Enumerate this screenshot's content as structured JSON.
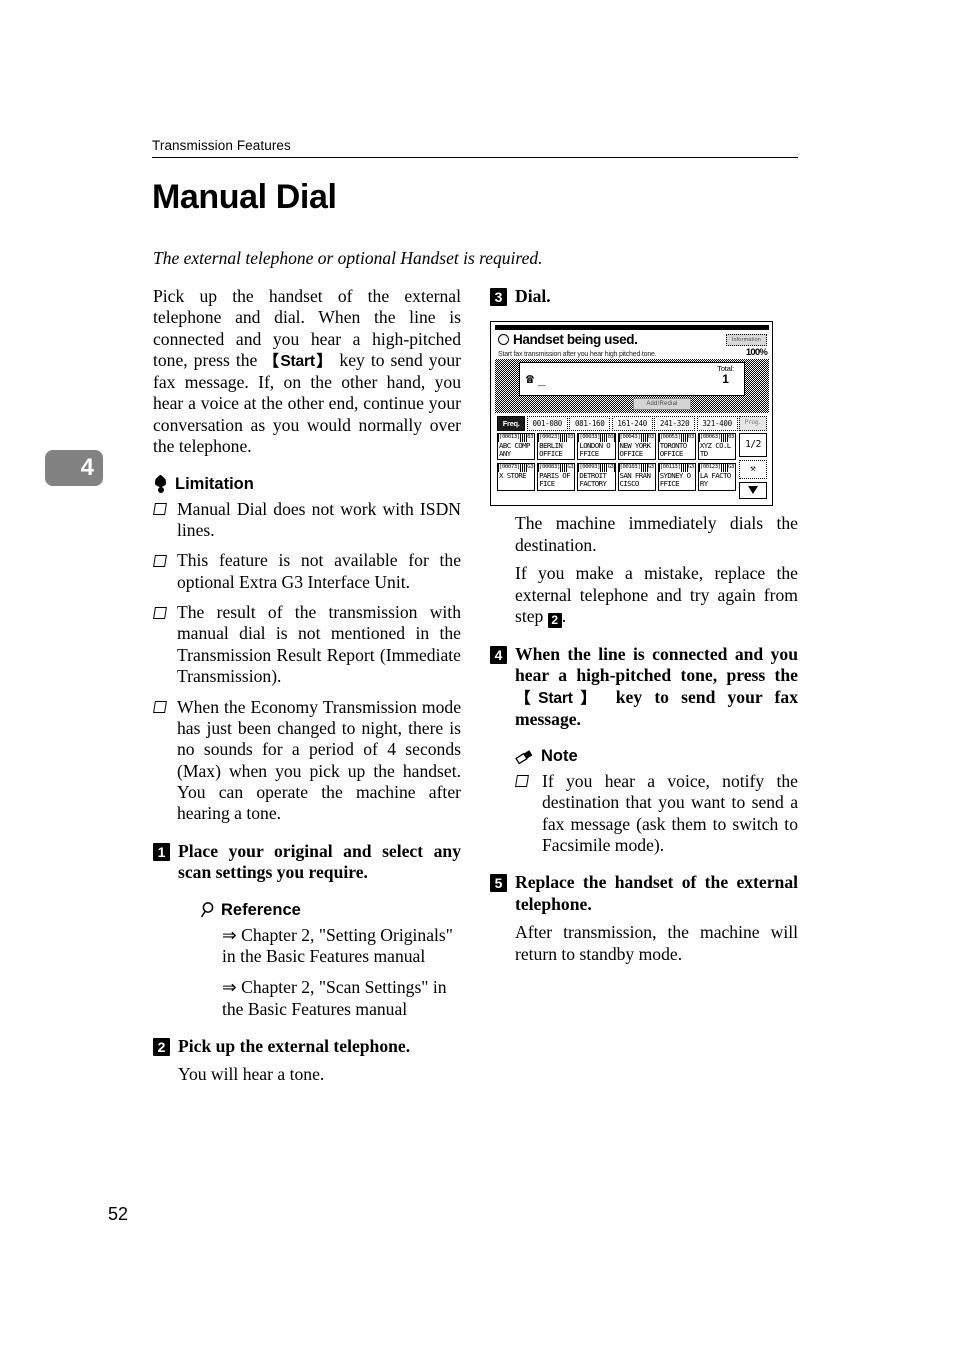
{
  "header": {
    "running_head": "Transmission Features"
  },
  "title": "Manual Dial",
  "intro_italic": "The external telephone or optional Handset is required.",
  "chapter_tab": "4",
  "page_number": "52",
  "left_column": {
    "intro_paragraph_part1": "Pick up the handset of the external telephone and dial. When the line is connected and you hear a high-pitched tone, press the ",
    "start_key": "【Start】",
    "intro_paragraph_part2": " key to send your fax message. If, on the other hand, you hear a voice at the other end, continue your conversation as you would normally over the telephone.",
    "limitation_heading": "Limitation",
    "limitation_icon": "balloon-icon",
    "limitations": [
      "Manual Dial does not work with ISDN lines.",
      "This feature is not available for the optional Extra G3 Interface Unit.",
      "The result of the transmission with manual dial is not mentioned in the Transmission Result Report (Immediate Transmission).",
      "When the Economy Transmission mode has just been changed to night, there is no sounds for a period of 4 seconds (Max) when you pick up the handset. You can operate the machine after hearing a tone."
    ],
    "step1": {
      "number": "1",
      "title": "Place your original and select any scan settings you require.",
      "reference_heading": "Reference",
      "reference_icon": "magnifier-icon",
      "references": [
        "⇒ Chapter 2, \"Setting Originals\" in the Basic Features manual",
        "⇒ Chapter 2, \"Scan Settings\" in the Basic Features manual"
      ]
    },
    "step2": {
      "number": "2",
      "title": "Pick up the external telephone.",
      "body": "You will hear a tone."
    }
  },
  "right_column": {
    "step3": {
      "number": "3",
      "title": "Dial.",
      "body1": "The machine immediately dials the destination.",
      "body2_part1": "If you make a mistake, replace the external telephone and try again from step ",
      "body2_step_ref": "2",
      "body2_part2": "."
    },
    "step4": {
      "number": "4",
      "title_part1": "When the line is connected and you hear a high-pitched tone, press the ",
      "start_key": "【Start】",
      "title_part2": " key to send your fax message.",
      "note_heading": "Note",
      "note_icon": "pencil-icon",
      "notes": [
        "If you hear a voice, notify the destination that you want to send a fax message (ask them to switch to Facsimile mode)."
      ]
    },
    "step5": {
      "number": "5",
      "title": "Replace the handset of the external telephone.",
      "body": "After transmission, the machine will return to standby mode."
    }
  },
  "lcd_screen": {
    "status_icon": "ring-icon",
    "status_title": "Handset being used.",
    "info_button": "Information",
    "subtitle": "Start fax transmission after you hear high pitched tone.",
    "percent": "100%",
    "phone_icon": "telephone-icon",
    "entry_value": "_",
    "total_label": "Total:",
    "total_value": "1",
    "add_redial_button": "Add/Redial",
    "tabs": [
      {
        "label": "Freq.",
        "selected": true
      },
      {
        "label": "001-080",
        "selected": false
      },
      {
        "label": "081-160",
        "selected": false
      },
      {
        "label": "161-240",
        "selected": false
      },
      {
        "label": "241-320",
        "selected": false
      },
      {
        "label": "321-400",
        "selected": false
      }
    ],
    "tab_overflow": "Prog.",
    "speed_dials_row1": [
      {
        "code": "[00013]",
        "type": "03",
        "line1": "ABC COMP",
        "line2": "ANY"
      },
      {
        "code": "[00023]",
        "type": "03",
        "line1": "BERLIN",
        "line2": "OFFICE"
      },
      {
        "code": "[00033]",
        "type": "03",
        "line1": "LONDON O",
        "line2": "FFICE"
      },
      {
        "code": "[00043]",
        "type": "03",
        "line1": "NEW YORK",
        "line2": "OFFICE"
      },
      {
        "code": "[00053]",
        "type": "03",
        "line1": "TORONTO",
        "line2": "OFFICE"
      },
      {
        "code": "[00063]",
        "type": "03",
        "line1": "XYZ CO.L",
        "line2": "TD"
      }
    ],
    "speed_dials_row2": [
      {
        "code": "[00073]",
        "type": "G3",
        "line1": "X STORE",
        "line2": ""
      },
      {
        "code": "[00083]",
        "type": "G3",
        "line1": "PARIS OF",
        "line2": "FICE"
      },
      {
        "code": "[00093]",
        "type": "G3",
        "line1": "DETROIT",
        "line2": "FACTORY"
      },
      {
        "code": "[00103]",
        "type": "G3",
        "line1": "SAN FRAN",
        "line2": "CISCO"
      },
      {
        "code": "[00113]",
        "type": "G3",
        "line1": "SYDNEY O",
        "line2": "FFICE"
      },
      {
        "code": "[00123]",
        "type": "G3",
        "line1": "LA FACTO",
        "line2": "RY"
      }
    ],
    "page_indicator": "1/2",
    "switch_button_icon": "switch-icon",
    "scroll_down_icon": "triangle-down-icon"
  }
}
